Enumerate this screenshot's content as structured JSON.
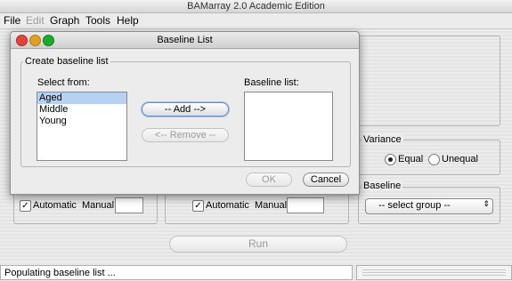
{
  "window": {
    "title": "BAMarray 2.0 Academic Edition"
  },
  "menubar": {
    "items": [
      {
        "label": "File",
        "enabled": true
      },
      {
        "label": "Edit",
        "enabled": false
      },
      {
        "label": "Graph",
        "enabled": true
      },
      {
        "label": "Tools",
        "enabled": true
      },
      {
        "label": "Help",
        "enabled": true
      }
    ]
  },
  "background": {
    "automatic_label_1": "Automatic",
    "manual_label_1": "Manual",
    "automatic_label_2": "Automatic",
    "manual_label_2": "Manual",
    "manual_value_1": "",
    "manual_value_2": "",
    "variance": {
      "title": "Variance",
      "options": [
        "Equal",
        "Unequal"
      ],
      "selected": "Equal"
    },
    "baseline": {
      "title": "Baseline",
      "select_value": "-- select group --"
    },
    "run_button": "Run"
  },
  "dialog": {
    "title": "Baseline List",
    "group_title": "Create baseline list",
    "select_from_label": "Select from:",
    "select_from_items": [
      "Aged",
      "Middle",
      "Young"
    ],
    "selected_item": "Aged",
    "add_button": "-- Add -->",
    "remove_button": "<-- Remove --",
    "baseline_list_label": "Baseline list:",
    "baseline_list_items": [],
    "ok_button": "OK",
    "cancel_button": "Cancel"
  },
  "status": {
    "text": "Populating baseline list ..."
  },
  "colors": {
    "selection": "#b6d2f2",
    "close": "#e0443e",
    "minimize": "#dea123",
    "zoom": "#1aab29"
  }
}
